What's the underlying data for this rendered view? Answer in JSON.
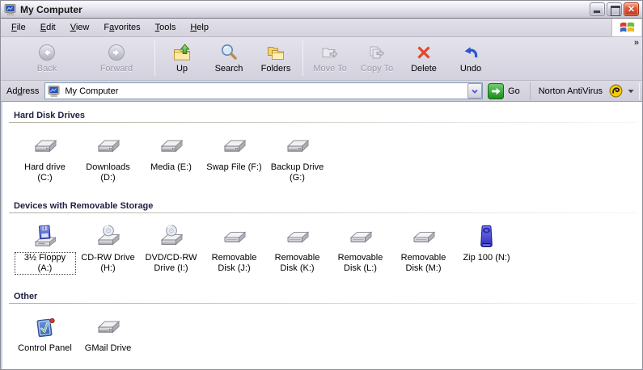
{
  "window": {
    "title": "My Computer",
    "icon": "my-computer-icon"
  },
  "menu_bar": {
    "items": [
      {
        "label": "File",
        "underline_index": 0
      },
      {
        "label": "Edit",
        "underline_index": 0
      },
      {
        "label": "View",
        "underline_index": 0
      },
      {
        "label": "Favorites",
        "underline_index": 1
      },
      {
        "label": "Tools",
        "underline_index": 0
      },
      {
        "label": "Help",
        "underline_index": 0
      }
    ],
    "logo_icon": "windows-flag-icon"
  },
  "toolbar": {
    "buttons": [
      {
        "label": "Back",
        "icon": "back-icon",
        "disabled": true,
        "wide": true
      },
      {
        "label": "Forward",
        "icon": "forward-icon",
        "disabled": true,
        "wide": true
      },
      {
        "label": "Up",
        "icon": "up-folder-icon",
        "disabled": false,
        "separator_before": true
      },
      {
        "label": "Search",
        "icon": "search-icon",
        "disabled": false
      },
      {
        "label": "Folders",
        "icon": "folders-icon",
        "disabled": false
      },
      {
        "label": "Move To",
        "icon": "move-to-icon",
        "disabled": true,
        "separator_before": true
      },
      {
        "label": "Copy To",
        "icon": "copy-to-icon",
        "disabled": true
      },
      {
        "label": "Delete",
        "icon": "delete-icon",
        "disabled": false
      },
      {
        "label": "Undo",
        "icon": "undo-icon",
        "disabled": false
      }
    ],
    "overflow_chevron": "»"
  },
  "address_bar": {
    "label": "Address",
    "label_underline_index": 2,
    "value": "My Computer",
    "value_icon": "my-computer-icon",
    "dropdown_icon": "combo-arrow-icon",
    "go_label": "Go",
    "go_icon": "go-arrow-icon",
    "norton": {
      "label": "Norton AntiVirus",
      "icon": "norton-icon",
      "caret_icon": "caret-down-icon"
    }
  },
  "content": {
    "sections": [
      {
        "title": "Hard Disk Drives",
        "items": [
          {
            "label": "Hard drive (C:)",
            "icon": "hard-drive-icon"
          },
          {
            "label": "Downloads (D:)",
            "icon": "hard-drive-icon"
          },
          {
            "label": "Media (E:)",
            "icon": "hard-drive-icon"
          },
          {
            "label": "Swap File (F:)",
            "icon": "hard-drive-icon"
          },
          {
            "label": "Backup Drive (G:)",
            "icon": "hard-drive-icon"
          }
        ]
      },
      {
        "title": "Devices with Removable Storage",
        "items": [
          {
            "label": "3½ Floppy (A:)",
            "icon": "floppy-drive-icon",
            "focused": true
          },
          {
            "label": "CD-RW Drive (H:)",
            "icon": "cd-drive-icon"
          },
          {
            "label": "DVD/CD-RW Drive (I:)",
            "icon": "cd-drive-icon"
          },
          {
            "label": "Removable Disk (J:)",
            "icon": "removable-disk-icon"
          },
          {
            "label": "Removable Disk (K:)",
            "icon": "removable-disk-icon"
          },
          {
            "label": "Removable Disk (L:)",
            "icon": "removable-disk-icon"
          },
          {
            "label": "Removable Disk (M:)",
            "icon": "removable-disk-icon"
          },
          {
            "label": "Zip 100 (N:)",
            "icon": "zip-drive-icon"
          }
        ]
      },
      {
        "title": "Other",
        "items": [
          {
            "label": "Control Panel",
            "icon": "control-panel-icon"
          },
          {
            "label": "GMail Drive",
            "icon": "hard-drive-icon"
          }
        ]
      }
    ]
  },
  "colors": {
    "chrome_bg": "#D8D7E0",
    "titlebar_top": "#FBFBFD",
    "titlebar_bottom": "#C9C8D6",
    "close_button": "#D6492F",
    "go_green": "#2E9C2E",
    "norton_yellow": "#F6C80A",
    "section_header_text": "#1F1F44",
    "field_border": "#7F9DB9",
    "content_bg": "#FFFFFF"
  }
}
